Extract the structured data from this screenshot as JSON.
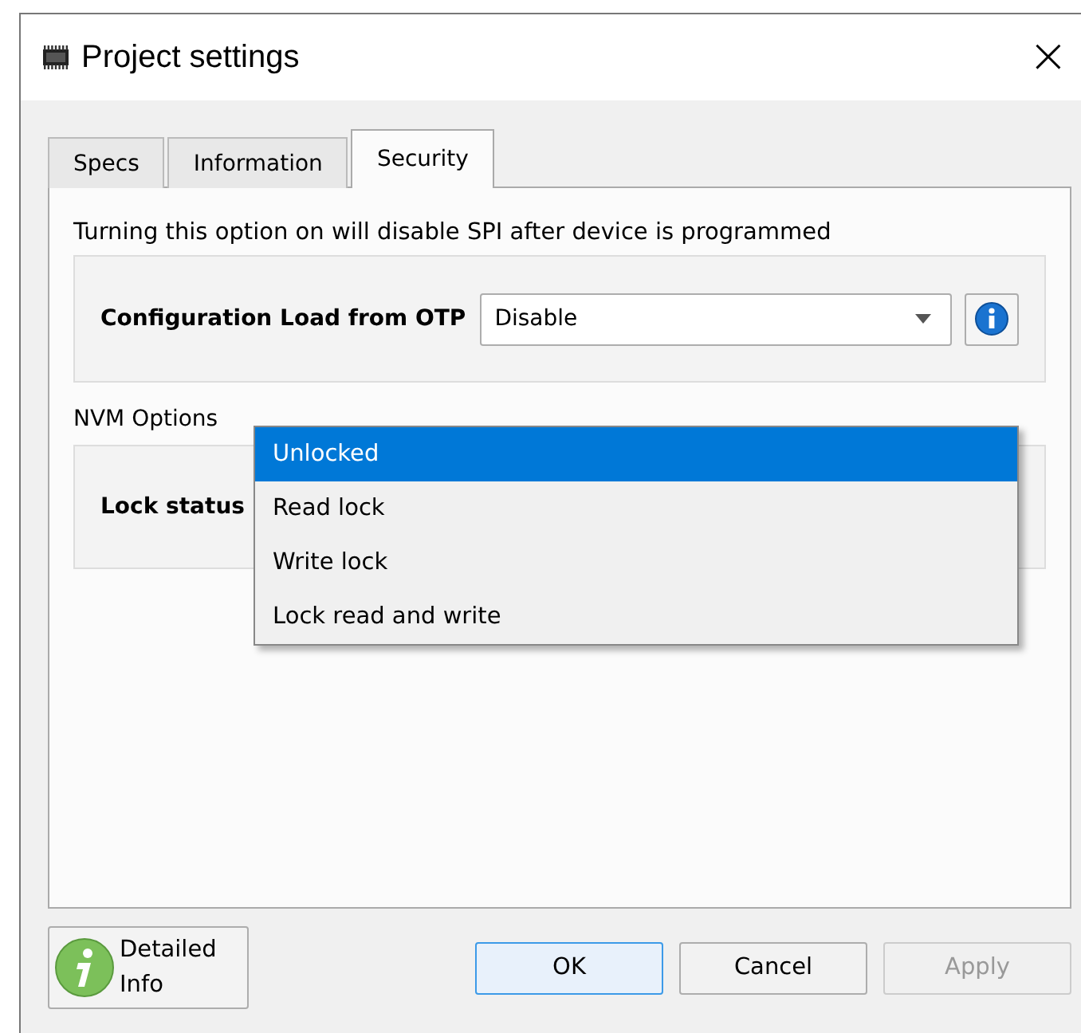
{
  "window": {
    "title": "Project settings",
    "close": "×"
  },
  "tabs": [
    {
      "label": "Specs",
      "selected": false
    },
    {
      "label": "Information",
      "selected": false
    },
    {
      "label": "Security",
      "selected": true
    }
  ],
  "security": {
    "note": "Turning this option on will disable SPI after device is programmed",
    "config_label": "Configuration Load from OTP",
    "config_value": "Disable",
    "nvm_title": "NVM Options",
    "lock_label": "Lock status",
    "lock_menu": [
      {
        "label": "Unlocked",
        "selected": true
      },
      {
        "label": "Read lock",
        "selected": false
      },
      {
        "label": "Write lock",
        "selected": false
      },
      {
        "label": "Lock read and write",
        "selected": false
      }
    ]
  },
  "detailed_info": {
    "line1": "Detailed",
    "line2": "Info"
  },
  "buttons": [
    {
      "label": "OK",
      "default": true,
      "disabled": false
    },
    {
      "label": "Cancel",
      "default": false,
      "disabled": false
    },
    {
      "label": "Apply",
      "default": false,
      "disabled": true
    }
  ]
}
